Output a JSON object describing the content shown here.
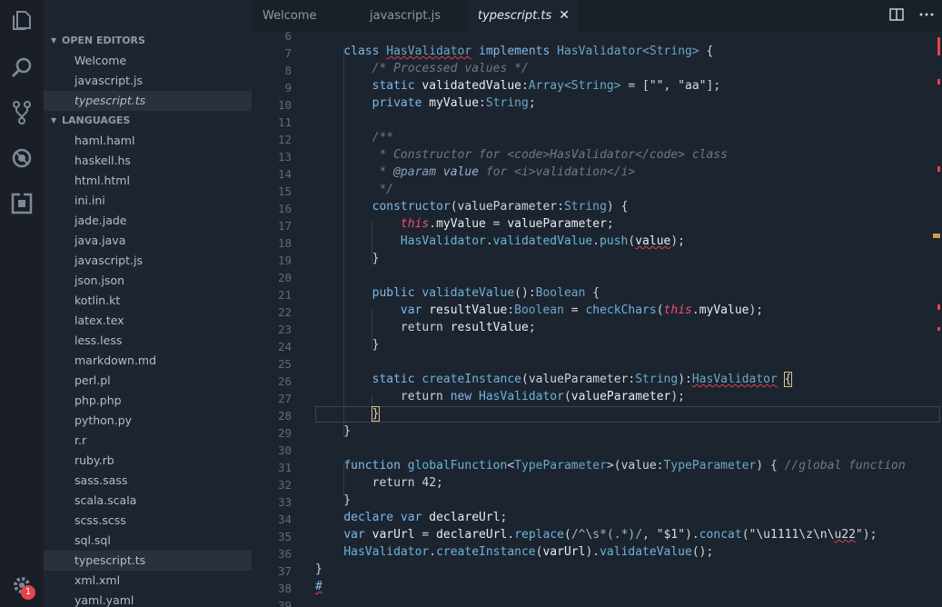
{
  "colors": {
    "accent_error": "#e8434b",
    "cursor_bracket": "#e0c070",
    "ruler_warn": "#c8a040"
  },
  "activity": {
    "icons": [
      "files-icon",
      "search-icon",
      "source-control-icon",
      "debug-icon",
      "extensions-icon"
    ],
    "settings_badge": "1"
  },
  "sidebar": {
    "open_editors_header": "OPEN EDITORS",
    "open_editors": [
      "Welcome",
      "javascript.js",
      "typescript.ts"
    ],
    "languages_header": "LANGUAGES",
    "languages": [
      "haml.haml",
      "haskell.hs",
      "html.html",
      "ini.ini",
      "jade.jade",
      "java.java",
      "javascript.js",
      "json.json",
      "kotlin.kt",
      "latex.tex",
      "less.less",
      "markdown.md",
      "perl.pl",
      "php.php",
      "python.py",
      "r.r",
      "ruby.rb",
      "sass.sass",
      "scala.scala",
      "scss.scss",
      "sql.sql",
      "typescript.ts",
      "xml.xml",
      "yaml.yaml"
    ]
  },
  "tabs": [
    {
      "label": "Welcome",
      "active": false
    },
    {
      "label": "javascript.js",
      "active": false
    },
    {
      "label": "typescript.ts",
      "active": true
    }
  ],
  "tab_close": "✕",
  "editor": {
    "line_numbers": [
      "6",
      "7",
      "8",
      "9",
      "10",
      "11",
      "12",
      "13",
      "14",
      "15",
      "16",
      "17",
      "18",
      "19",
      "20",
      "21",
      "22",
      "23",
      "24",
      "25",
      "26",
      "27",
      "28",
      "29",
      "30",
      "31",
      "32",
      "33",
      "34",
      "35",
      "36",
      "37",
      "38",
      "39"
    ]
  }
}
